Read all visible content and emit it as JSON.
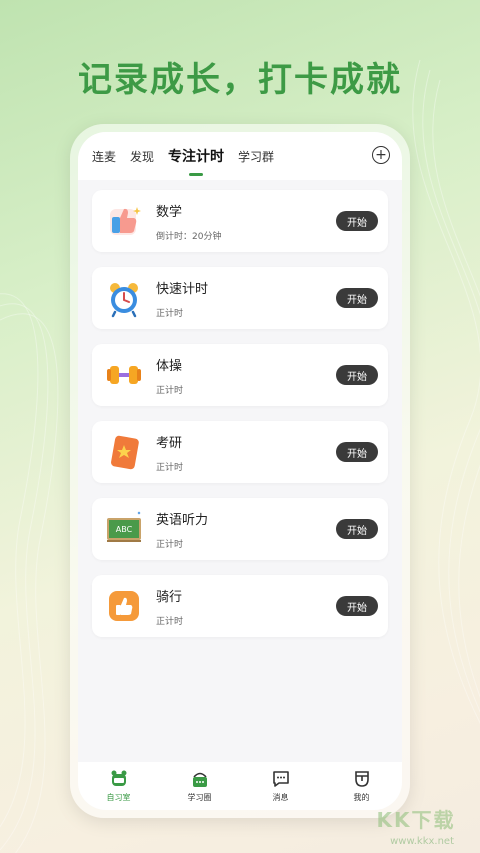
{
  "headline": "记录成长，打卡成就",
  "tabs": [
    {
      "label": "连麦"
    },
    {
      "label": "发现"
    },
    {
      "label": "专注计时"
    },
    {
      "label": "学习群"
    }
  ],
  "add_label": "+",
  "items": [
    {
      "title": "数学",
      "subtitle": "倒计时：20分钟",
      "button": "开始",
      "icon": "thumbs-up-icon"
    },
    {
      "title": "快速计时",
      "subtitle": "正计时",
      "button": "开始",
      "icon": "alarm-clock-icon"
    },
    {
      "title": "体操",
      "subtitle": "正计时",
      "button": "开始",
      "icon": "dumbbell-icon"
    },
    {
      "title": "考研",
      "subtitle": "正计时",
      "button": "开始",
      "icon": "notebook-icon"
    },
    {
      "title": "英语听力",
      "subtitle": "正计时",
      "button": "开始",
      "icon": "chalkboard-icon"
    },
    {
      "title": "骑行",
      "subtitle": "正计时",
      "button": "开始",
      "icon": "thumbs-up-square-icon"
    }
  ],
  "chalkboard_text": "ABC",
  "nav": [
    {
      "label": "自习室",
      "icon": "study-room-icon"
    },
    {
      "label": "学习圈",
      "icon": "study-circle-icon"
    },
    {
      "label": "消息",
      "icon": "message-icon"
    },
    {
      "label": "我的",
      "icon": "profile-icon"
    }
  ],
  "watermark": "KK下载",
  "watermark_url": "www.kkx.net",
  "colors": {
    "accent": "#3a9a45",
    "button": "#3a3a3a",
    "headline": "#3d9a45"
  }
}
